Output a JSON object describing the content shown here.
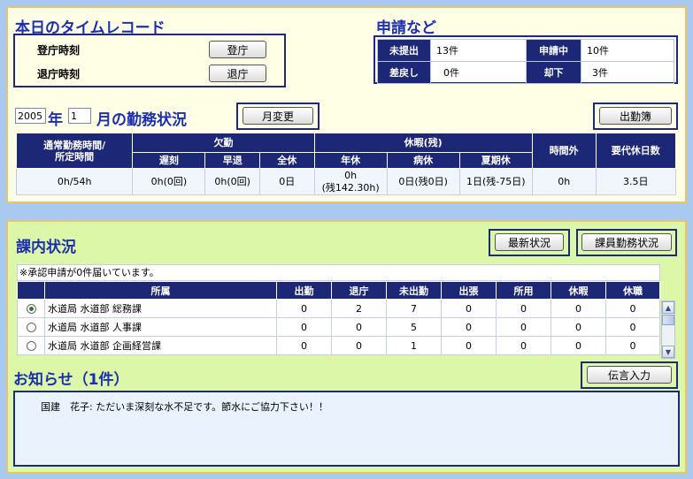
{
  "timecard": {
    "title": "本日のタイムレコード",
    "clock_in_label": "登庁時刻",
    "clock_out_label": "退庁時刻",
    "clock_in_button": "登庁",
    "clock_out_button": "退庁"
  },
  "requests": {
    "title": "申請など",
    "unsubmitted_label": "未提出",
    "unsubmitted_value": "13件",
    "pending_label": "申請中",
    "pending_value": "10件",
    "returned_label": "差戻し",
    "returned_value": "0件",
    "rejected_label": "却下",
    "rejected_value": "3件"
  },
  "work": {
    "year": "2005",
    "year_suffix": "年",
    "month": "1",
    "month_suffix": "月の勤務状況",
    "change_month_button": "月変更",
    "attendance_book_button": "出勤簿",
    "headers": {
      "normal_hours": "通常勤務時間/\n所定時間",
      "absence": "欠勤",
      "late": "遅刻",
      "early": "早退",
      "full_absence": "全休",
      "leave": "休暇(残)",
      "annual": "年休",
      "sick": "病休",
      "summer": "夏期休",
      "overtime": "時間外",
      "substitute": "要代休日数"
    },
    "row": {
      "normal_hours": "0h/54h",
      "late": "0h(0回)",
      "early": "0h(0回)",
      "full_absence": "0日",
      "annual": "0h\n(残142.30h)",
      "sick": "0日(残0日)",
      "summer": "1日(残-75日)",
      "overtime": "0h",
      "substitute": "3.5日"
    }
  },
  "division": {
    "title": "課内状況",
    "latest_button": "最新状況",
    "staff_button": "課員勤務状況",
    "message": "※承認申請が0件届いています。",
    "columns": [
      "所属",
      "出勤",
      "退庁",
      "未出勤",
      "出張",
      "所用",
      "休暇",
      "休職"
    ],
    "rows": [
      {
        "selected": true,
        "name": "水道局 水道部 総務課",
        "values": [
          "0",
          "2",
          "7",
          "0",
          "0",
          "0",
          "0"
        ]
      },
      {
        "selected": false,
        "name": "水道局 水道部 人事課",
        "values": [
          "0",
          "0",
          "5",
          "0",
          "0",
          "0",
          "0"
        ]
      },
      {
        "selected": false,
        "name": "水道局 水道部 企画経営課",
        "values": [
          "0",
          "0",
          "1",
          "0",
          "0",
          "0",
          "0"
        ]
      }
    ]
  },
  "notice": {
    "title": "お知らせ（1件）",
    "message_button": "伝言入力",
    "items": [
      "国建　花子: ただいま深刻な水不足です。節水にご協力下さい！！"
    ]
  },
  "colors": {
    "header_navy": "#1c2776",
    "title_blue": "#1c2fb0",
    "top_panel_bg": "#ffffe6",
    "bottom_panel_bg": "#dcf7a8",
    "page_bg": "#a9c9ee"
  }
}
